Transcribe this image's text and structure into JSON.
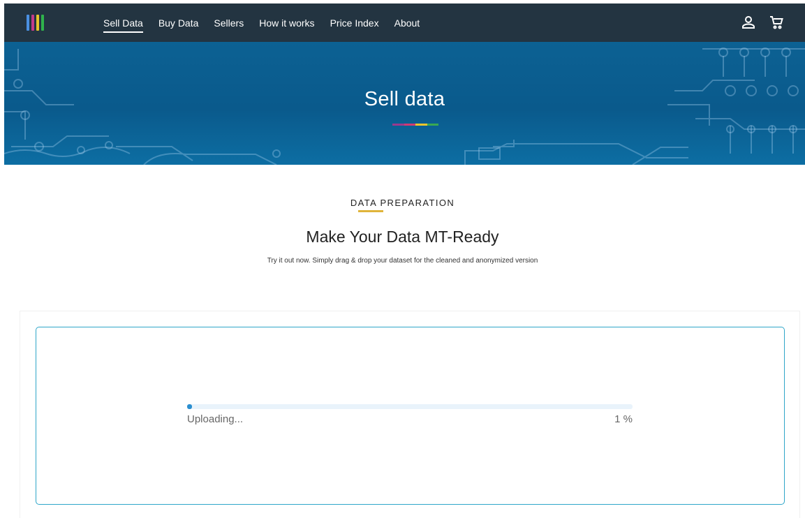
{
  "nav": {
    "links": [
      {
        "label": "Sell Data",
        "active": true
      },
      {
        "label": "Buy Data",
        "active": false
      },
      {
        "label": "Sellers",
        "active": false
      },
      {
        "label": "How it works",
        "active": false
      },
      {
        "label": "Price Index",
        "active": false
      },
      {
        "label": "About",
        "active": false
      }
    ],
    "logo_colors": [
      "#4a90e2",
      "#c23b8a",
      "#e8c42b",
      "#2fb24c"
    ],
    "icons": [
      "user-icon",
      "cart-icon"
    ]
  },
  "hero": {
    "title": "Sell data",
    "bar_colors": [
      "#9b3a8d",
      "#d03a73",
      "#f0c52b",
      "#3aa852"
    ]
  },
  "section": {
    "label": "DATA PREPARATION",
    "underline_color": "#e0b43a",
    "title": "Make Your Data MT-Ready",
    "subtitle": "Try it out now. Simply drag & drop your dataset for the cleaned and anonymized version"
  },
  "upload": {
    "status_text": "Uploading...",
    "percent_text": "1 %",
    "progress_fraction": 0.01,
    "border_color": "#2ea6c9",
    "fill_color": "#2b8fd0"
  }
}
